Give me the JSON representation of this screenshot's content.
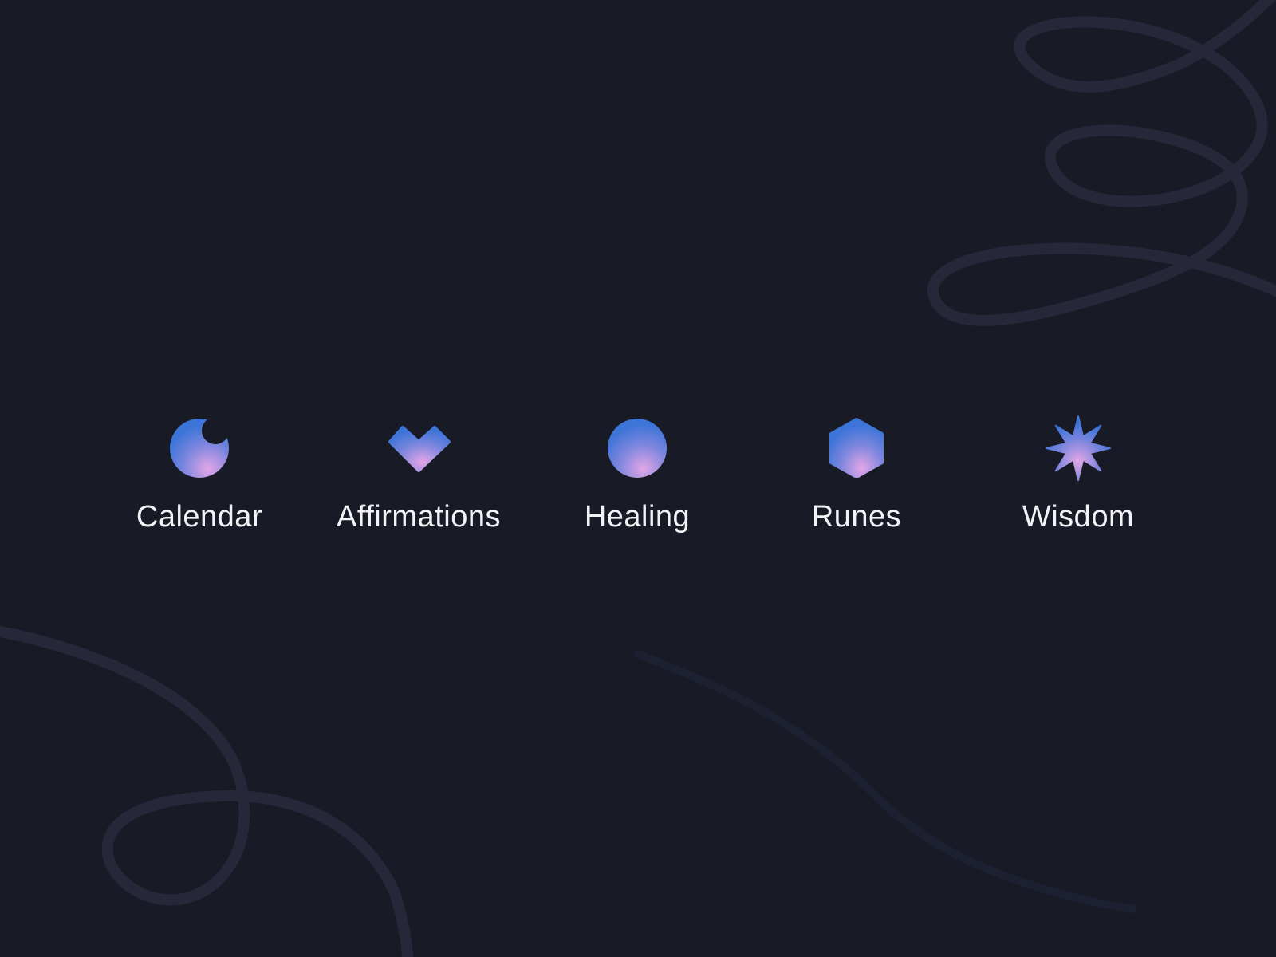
{
  "colors": {
    "background": "#181b26",
    "swirl_stroke": "#262839",
    "label_text": "#f3f3f7",
    "icon_gradient_start": "#3d74d8",
    "icon_gradient_end": "#e3a6e6"
  },
  "menu": {
    "items": [
      {
        "label": "Calendar",
        "icon": "moon-icon"
      },
      {
        "label": "Affirmations",
        "icon": "heart-icon"
      },
      {
        "label": "Healing",
        "icon": "circle-icon"
      },
      {
        "label": "Runes",
        "icon": "hexagon-icon"
      },
      {
        "label": "Wisdom",
        "icon": "star-icon"
      }
    ]
  }
}
